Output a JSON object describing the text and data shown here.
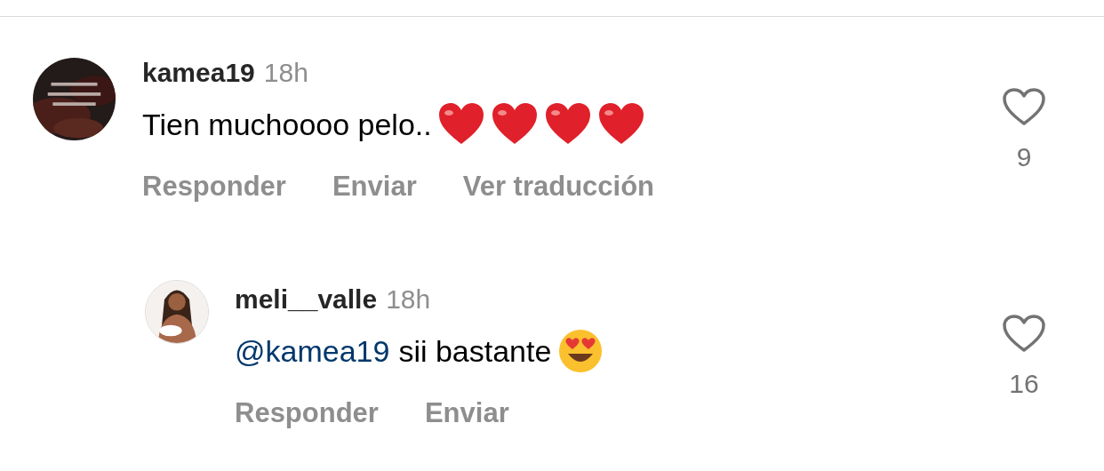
{
  "comments": [
    {
      "username": "kamea19",
      "time": "18h",
      "avatar": {
        "kind": "picture"
      },
      "text": "Tien muchoooo pelo..",
      "emojis": [
        {
          "kind": "heart"
        },
        {
          "kind": "heart"
        },
        {
          "kind": "heart"
        },
        {
          "kind": "heart"
        }
      ],
      "actions": [
        "Responder",
        "Enviar",
        "Ver traducción"
      ],
      "liked": false,
      "likes": "9",
      "children": [
        {
          "username": "meli__valle",
          "time": "18h",
          "avatar": {
            "kind": "picture"
          },
          "mention": "@kamea19",
          "text": "sii bastante",
          "emojis": [
            {
              "kind": "heart-eyes"
            }
          ],
          "actions": [
            "Responder",
            "Enviar"
          ],
          "liked": false,
          "likes": "16"
        }
      ]
    }
  ]
}
